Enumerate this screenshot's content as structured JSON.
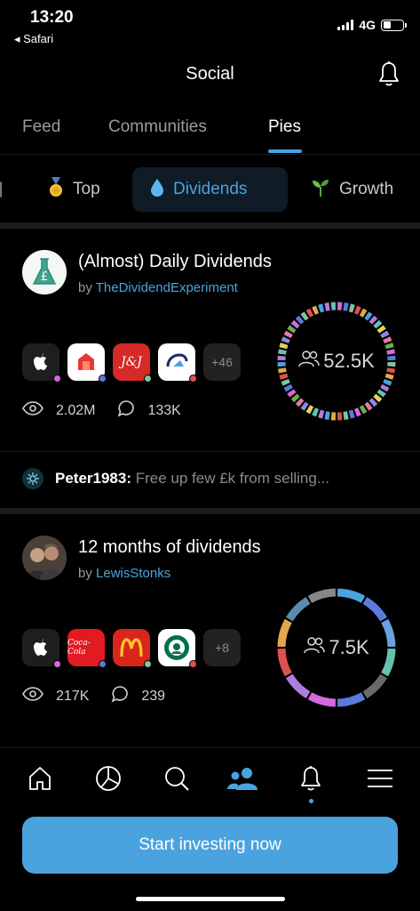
{
  "status": {
    "time": "13:20",
    "back_label": "◂ Safari",
    "network": "4G"
  },
  "header": {
    "title": "Social"
  },
  "tabs": [
    {
      "label": "Feed"
    },
    {
      "label": "Communities"
    },
    {
      "label": "Pies"
    }
  ],
  "filters": [
    {
      "label": "Top",
      "icon": "medal-icon"
    },
    {
      "label": "Dividends",
      "icon": "droplet-icon"
    },
    {
      "label": "Growth",
      "icon": "sprout-icon"
    }
  ],
  "pies": [
    {
      "title": "(Almost) Daily Dividends",
      "by_prefix": "by ",
      "author": "TheDividendExperiment",
      "more": "+46",
      "views": "2.02M",
      "comments": "133K",
      "followers": "52.5K"
    },
    {
      "title": "12 months of dividends",
      "by_prefix": "by ",
      "author": "LewisStonks",
      "more": "+8",
      "views": "217K",
      "comments": "239",
      "followers": "7.5K"
    }
  ],
  "comment": {
    "user": "Peter1983:",
    "text": " Free up few £k from selling..."
  },
  "cta": {
    "label": "Start investing now"
  },
  "colors": {
    "accent": "#4aa3df",
    "background": "#000000"
  }
}
